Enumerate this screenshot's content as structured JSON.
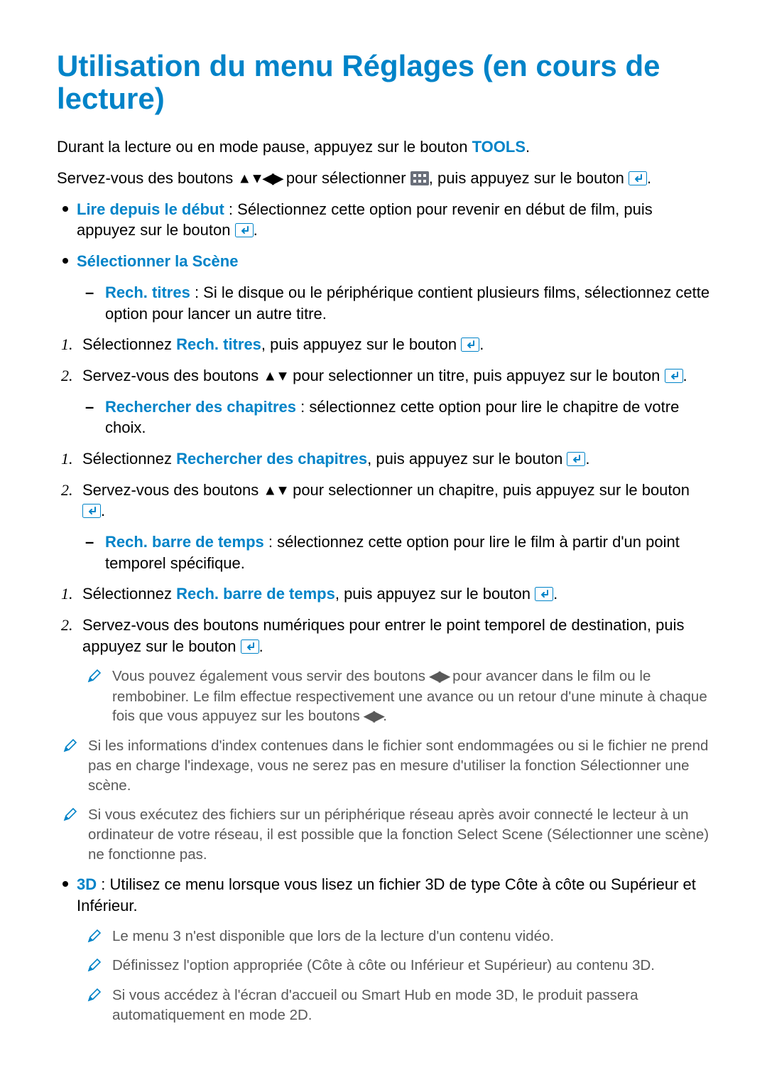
{
  "title": "Utilisation du menu Réglages (en cours de lecture)",
  "intro_para_1a": "Durant la lecture ou en mode pause, appuyez sur le bouton ",
  "intro_tools": "TOOLS",
  "intro_para_1b": ".",
  "intro_para_2a": "Servez-vous des boutons ",
  "arrows_udlr": "▲▼◀▶",
  "intro_para_2b": " pour sélectionner ",
  "intro_para_2c": ", puis appuyez sur le bouton ",
  "intro_para_2d": ".",
  "bullets": {
    "b1_term": "Lire depuis le début",
    "b1_text_a": " : Sélectionnez cette option pour revenir en début de film, puis appuyez sur le bouton ",
    "b1_text_b": ".",
    "b2_term": "Sélectionner la Scène",
    "b2_sub1_term": "Rech. titres",
    "b2_sub1_text": " : Si le disque ou le périphérique contient plusieurs films, sélectionnez cette option pour lancer un autre titre.",
    "b2_sub2_term": "Rechercher des chapitres",
    "b2_sub2_text": " : sélectionnez cette option pour lire le chapitre de votre choix.",
    "b2_sub3_term": "Rech. barre de temps",
    "b2_sub3_text": " : sélectionnez cette option pour lire le film à partir d'un point temporel spécifique.",
    "b3_term": "3D",
    "b3_text": " : Utilisez ce menu lorsque vous lisez un fichier 3D de type Côte à côte ou Supérieur et Inférieur."
  },
  "steps": {
    "titres": {
      "s1a": "Sélectionnez ",
      "s1_term": "Rech. titres",
      "s1b": ", puis appuyez sur le bouton ",
      "s1c": ".",
      "s2a": "Servez-vous des boutons ",
      "arrows_ud": "▲▼",
      "s2b": " pour selectionner un titre, puis appuyez sur le bouton ",
      "s2c": "."
    },
    "chapitres": {
      "s1a": "Sélectionnez ",
      "s1_term": "Rechercher des chapitres",
      "s1b": ", puis appuyez sur le bouton ",
      "s1c": ".",
      "s2a": "Servez-vous des boutons ",
      "arrows_ud": "▲▼",
      "s2b": " pour selectionner un chapitre, puis appuyez sur le bouton ",
      "s2c": "."
    },
    "temps": {
      "s1a": "Sélectionnez ",
      "s1_term": "Rech. barre de temps",
      "s1b": ", puis appuyez sur le bouton ",
      "s1c": ".",
      "s2a": "Servez-vous des boutons numériques pour entrer le point temporel de destination, puis appuyez sur le bouton ",
      "s2b": "."
    }
  },
  "notes": {
    "n1a": "Vous pouvez également vous servir des boutons ",
    "arrows_lr": "◀▶",
    "n1b": " pour avancer dans le film ou le rembobiner. Le film effectue respectivement une avance ou un retour d'une minute à chaque fois que vous appuyez sur les boutons ",
    "n1c": ".",
    "n2": "Si les informations d'index contenues dans le fichier sont endommagées ou si le fichier ne prend pas en charge l'indexage, vous ne serez pas en mesure d'utiliser la fonction Sélectionner une scène.",
    "n3": "Si vous exécutez des fichiers sur un périphérique réseau après avoir connecté le lecteur à un ordinateur de votre réseau, il est possible que la fonction Select Scene (Sélectionner une scène) ne fonctionne pas.",
    "n4": "Le menu 3 n'est disponible que lors de la lecture d'un contenu vidéo.",
    "n5": "Définissez l'option appropriée (Côte à côte ou Inférieur et Supérieur) au contenu 3D.",
    "n6": "Si vous accédez à l'écran d'accueil ou Smart Hub en mode 3D, le produit passera automatiquement en mode 2D."
  }
}
